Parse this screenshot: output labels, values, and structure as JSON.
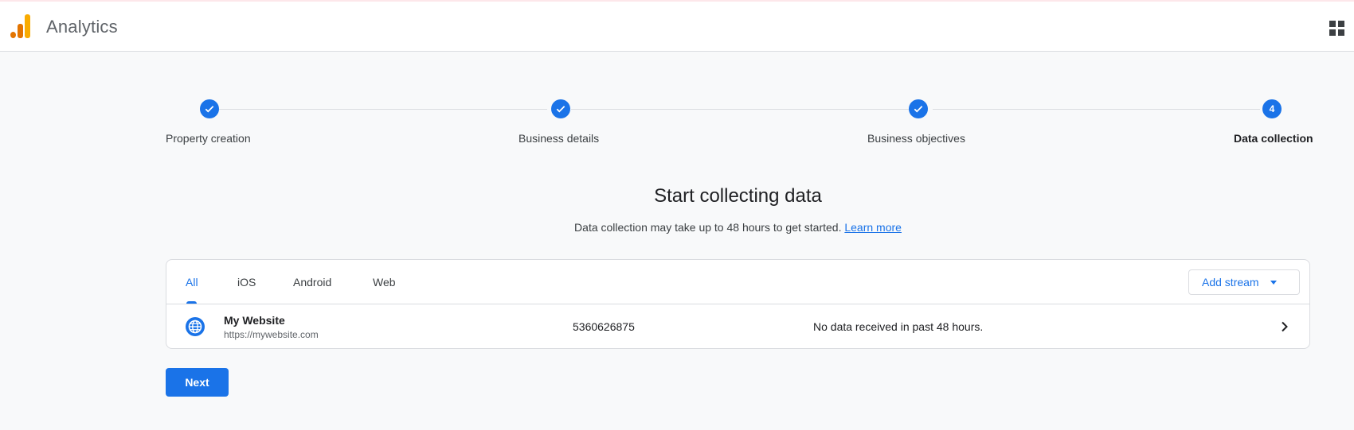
{
  "header": {
    "app_title": "Analytics",
    "logo_colors": [
      "#f9ab00",
      "#e37400"
    ],
    "apps_icon": "apps-grid-icon"
  },
  "stepper": {
    "steps": [
      {
        "label": "Property creation",
        "state": "complete",
        "marker": "check-icon"
      },
      {
        "label": "Business details",
        "state": "complete",
        "marker": "check-icon"
      },
      {
        "label": "Business objectives",
        "state": "complete",
        "marker": "check-icon"
      },
      {
        "label": "Data collection",
        "state": "current",
        "number": "4"
      }
    ]
  },
  "main": {
    "heading": "Start collecting data",
    "subtext": "Data collection may take up to 48 hours to get started.",
    "learn_more": "Learn more"
  },
  "streams": {
    "tabs": [
      {
        "label": "All",
        "active": true
      },
      {
        "label": "iOS",
        "active": false
      },
      {
        "label": "Android",
        "active": false
      },
      {
        "label": "Web",
        "active": false
      }
    ],
    "add_stream_label": "Add stream",
    "rows": [
      {
        "name": "My Website",
        "url": "https://mywebsite.com",
        "id": "5360626875",
        "status": "No data received in past 48 hours.",
        "icon": "globe-icon"
      }
    ]
  },
  "footer": {
    "next_label": "Next"
  },
  "colors": {
    "accent": "#1a73e8",
    "background": "#f8f9fa"
  }
}
